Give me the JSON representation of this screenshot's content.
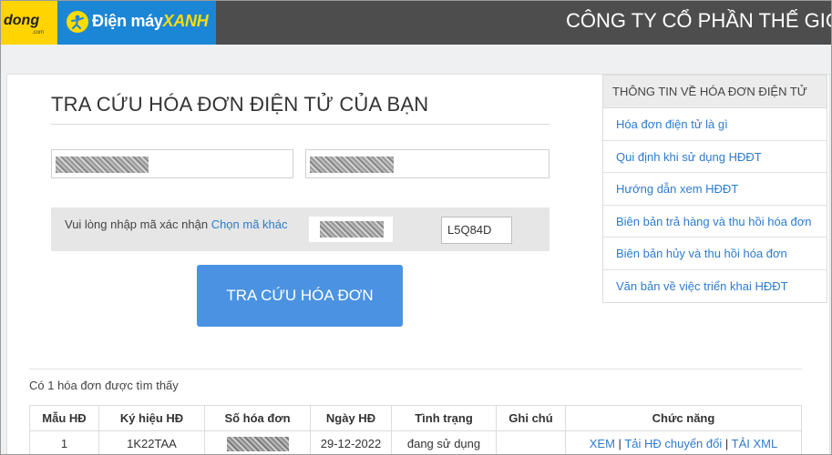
{
  "header": {
    "logo_tgdd_text": "dong",
    "logo_tgdd_sub": ".com",
    "logo_dmx_prefix": "Điện máy",
    "logo_dmx_highlight": "XANH",
    "company_name": "CÔNG TY CỔ PHẦN THẾ GIỚI"
  },
  "lookup": {
    "title": "TRA CỨU HÓA ĐƠN ĐIỆN TỬ CỦA BẠN",
    "captcha_prompt": "Vui lòng nhập mã xác nhận ",
    "captcha_change_link": "Chọn mã khác",
    "captcha_value": "L5Q84D",
    "search_button": "TRA CỨU HÓA ĐƠN"
  },
  "results": {
    "count_text": "Có 1 hóa đơn được tìm thấy",
    "columns": [
      "Mẫu HĐ",
      "Ký hiệu HĐ",
      "Số hóa đơn",
      "Ngày HĐ",
      "Tình trạng",
      "Ghi chú",
      "Chức năng"
    ],
    "rows": [
      {
        "mau": "1",
        "ky_hieu": "1K22TAA",
        "ngay": "29-12-2022",
        "tinh_trang": "đang sử dụng",
        "ghi_chu": "",
        "actions": {
          "view": "XEM",
          "sep1": " | ",
          "download_converted": "Tải HĐ chuyển đổi",
          "sep2": " | ",
          "download_xml": "TẢI XML"
        }
      }
    ]
  },
  "sidebar": {
    "heading": "THÔNG TIN VỀ HÓA ĐƠN ĐIỆN TỬ",
    "items": [
      "Hóa đơn điện tử là gì",
      "Qui định khi sử dụng HĐĐT",
      "Hướng dẫn xem HĐĐT",
      "Biên bản trả hàng và thu hồi hóa đơn",
      "Biên bản hủy và thu hồi hóa đơn",
      "Văn bản về việc triển khai HĐĐT"
    ]
  },
  "colors": {
    "header_bg": "#4d4d4d",
    "tgdd_yellow": "#ffd400",
    "dmx_blue": "#1c86d6",
    "button_blue": "#4b93e2",
    "link_blue": "#2e7bcf"
  }
}
